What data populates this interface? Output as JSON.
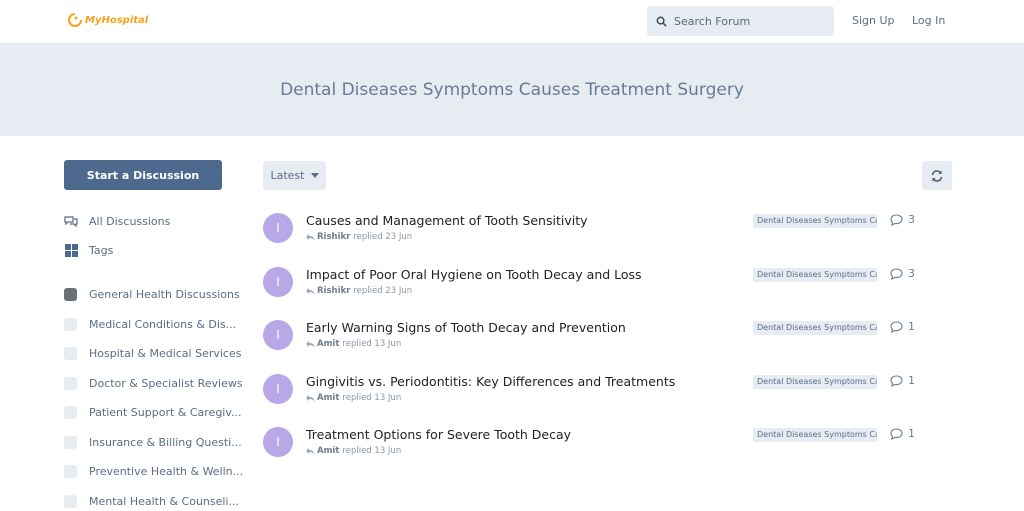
{
  "header": {
    "logo_text": "MyHospital",
    "search_placeholder": "Search Forum",
    "signup_label": "Sign Up",
    "login_label": "Log In"
  },
  "hero": {
    "title": "Dental Diseases Symptoms Causes Treatment Surgery"
  },
  "sidebar": {
    "start_label": "Start a Discussion",
    "all_discussions_label": "All Discussions",
    "tags_label": "Tags",
    "tags": [
      "General Health Discussions",
      "Medical Conditions & Dis...",
      "Hospital & Medical Services",
      "Doctor & Specialist Reviews",
      "Patient Support & Caregiv...",
      "Insurance & Billing Questi...",
      "Preventive Health & Welln...",
      "Mental Health & Counseli..."
    ]
  },
  "toolbar": {
    "sort_label": "Latest"
  },
  "discussions": [
    {
      "avatar": "I",
      "title": "Causes and Management of Tooth Sensitivity",
      "user": "Rishikr",
      "action": "replied 23 Jun",
      "tag": "Dental Diseases Symptoms Ca",
      "count": "3"
    },
    {
      "avatar": "I",
      "title": "Impact of Poor Oral Hygiene on Tooth Decay and Loss",
      "user": "Rishikr",
      "action": "replied 23 Jun",
      "tag": "Dental Diseases Symptoms Ca",
      "count": "3"
    },
    {
      "avatar": "I",
      "title": "Early Warning Signs of Tooth Decay and Prevention",
      "user": "Amit",
      "action": "replied 13 Jun",
      "tag": "Dental Diseases Symptoms Ca",
      "count": "1"
    },
    {
      "avatar": "I",
      "title": "Gingivitis vs. Periodontitis: Key Differences and Treatments",
      "user": "Amit",
      "action": "replied 13 Jun",
      "tag": "Dental Diseases Symptoms Ca",
      "count": "1"
    },
    {
      "avatar": "I",
      "title": "Treatment Options for Severe Tooth Decay",
      "user": "Amit",
      "action": "replied 13 Jun",
      "tag": "Dental Diseases Symptoms Ca",
      "count": "1"
    }
  ]
}
